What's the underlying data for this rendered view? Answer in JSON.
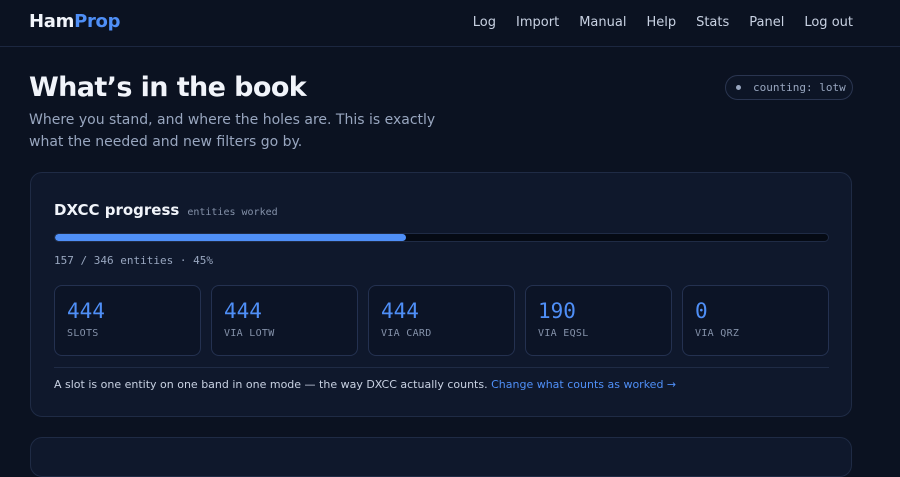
{
  "nav": {
    "brand_a": "Ham",
    "brand_b": "Prop",
    "links": [
      "Log",
      "Import",
      "Manual",
      "Help",
      "Stats",
      "Panel",
      "Log out"
    ]
  },
  "page": {
    "title": "What’s in the book",
    "subtitle": "Where you stand, and where the holes are. This is exactly what the needed and new filters go by.",
    "counting_pill": "counting: lotw"
  },
  "dxcc": {
    "title": "DXCC progress",
    "tag": "entities worked",
    "progress_fraction": 0.4538,
    "progress_text": "157 / 346 entities · 45%",
    "stats": [
      {
        "value": "444",
        "label": "SLOTS"
      },
      {
        "value": "444",
        "label": "VIA LOTW"
      },
      {
        "value": "444",
        "label": "VIA CARD"
      },
      {
        "value": "190",
        "label": "VIA EQSL"
      },
      {
        "value": "0",
        "label": "VIA QRZ"
      }
    ],
    "note": "A slot is one entity on one band in one mode — the way DXCC actually counts.",
    "note_link": "Change what counts as worked →"
  },
  "colors": {
    "accent": "#4f8ff7",
    "background": "#0b1221",
    "card": "#0f182c"
  }
}
